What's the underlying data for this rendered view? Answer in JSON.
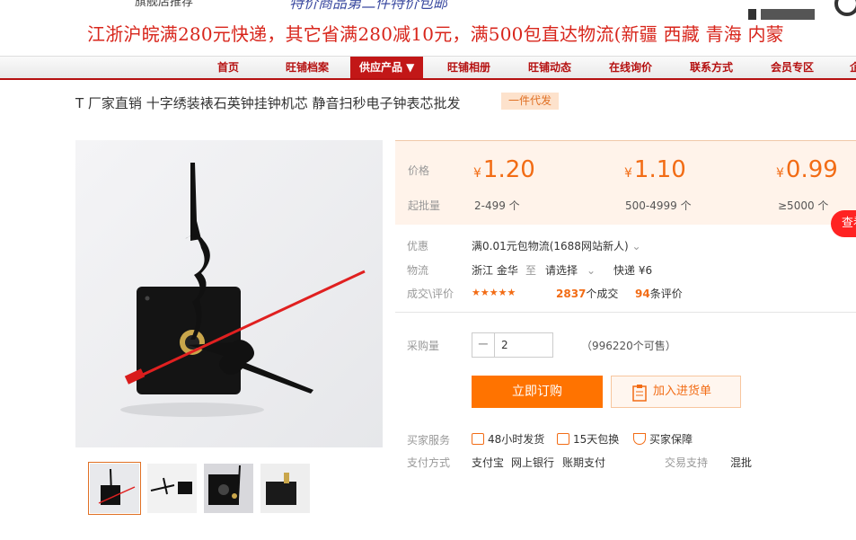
{
  "banner": {
    "top_text_left": "旗舰店推荐",
    "top_text_mid": "特价商品第二件特价包邮",
    "promo": "江浙沪皖满280元快递，其它省满280减10元，满500包直达物流(新疆 西藏 青海 内蒙"
  },
  "nav": {
    "items": [
      "首页",
      "旺铺档案",
      "供应产品 ▼",
      "旺铺相册",
      "旺铺动态",
      "在线询价",
      "联系方式",
      "会员专区",
      "企"
    ]
  },
  "product": {
    "title": "T 厂家直销 十字绣装裱石英钟挂钟机芯 静音扫秒电子钟表芯批发",
    "badge": "一件代发"
  },
  "pricing": {
    "price_label": "价格",
    "moq_label": "起批量",
    "currency": "¥",
    "tiers": [
      {
        "price": "1.20",
        "range": "2-499 个"
      },
      {
        "price": "1.10",
        "range": "500-4999 个"
      },
      {
        "price": "0.99",
        "range": "≥5000 个"
      }
    ]
  },
  "search_bubble": "查看",
  "details": {
    "discount_label": "优惠",
    "discount_value": "满0.01元包物流(1688网站新人)",
    "logistics_label": "物流",
    "origin": "浙江 金华",
    "to": "至",
    "dest_placeholder": "请选择",
    "shipping": "快递 ¥6",
    "deals_label": "成交\\评价",
    "stars": "★★★★★",
    "deals_count": "2837",
    "deals_suffix": "个成交",
    "review_count": "94",
    "review_suffix": "条评价"
  },
  "purchase": {
    "qty_label": "采购量",
    "minus": "−",
    "qty_value": "2",
    "available": "（996220个可售）",
    "buy_button": "立即订购",
    "cart_button": "加入进货单"
  },
  "services": {
    "label": "买家服务",
    "items": [
      "48小时发货",
      "15天包换",
      "买家保障"
    ]
  },
  "payment": {
    "label": "支付方式",
    "methods": [
      "支付宝",
      "网上银行",
      "账期支付"
    ],
    "trade_label": "交易支持",
    "trade_value": "混批"
  },
  "colors": {
    "accent": "#f26c15",
    "brand_red": "#c21717",
    "promo_red": "#d8261c"
  }
}
